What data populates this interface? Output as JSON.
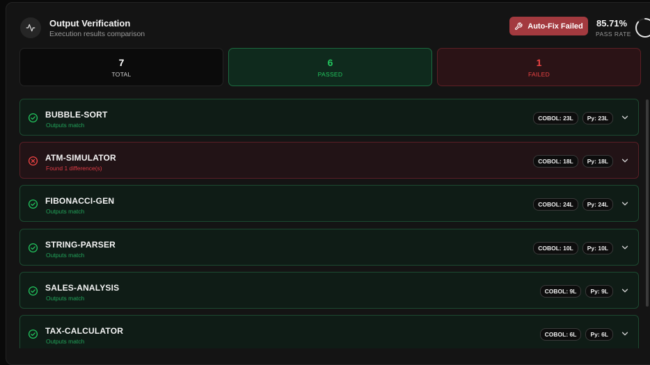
{
  "header": {
    "title": "Output Verification",
    "subtitle": "Execution results comparison",
    "autofix_label": "Auto-Fix Failed",
    "pass_rate": "85.71%",
    "pass_rate_label": "PASS RATE",
    "pass_rate_fraction": 0.8571
  },
  "stats": [
    {
      "value": "7",
      "label": "TOTAL"
    },
    {
      "value": "6",
      "label": "PASSED"
    },
    {
      "value": "1",
      "label": "FAILED"
    }
  ],
  "colors": {
    "pass": "#22c55e",
    "fail": "#ef4444",
    "autofix_bg": "#a33a3f"
  },
  "results": [
    {
      "name": "BUBBLE-SORT",
      "status": "pass",
      "message": "Outputs match",
      "cobol": "COBOL: 23L",
      "py": "Py: 23L"
    },
    {
      "name": "ATM-SIMULATOR",
      "status": "fail",
      "message": "Found 1 difference(s)",
      "cobol": "COBOL: 18L",
      "py": "Py: 18L"
    },
    {
      "name": "FIBONACCI-GEN",
      "status": "pass",
      "message": "Outputs match",
      "cobol": "COBOL: 24L",
      "py": "Py: 24L"
    },
    {
      "name": "STRING-PARSER",
      "status": "pass",
      "message": "Outputs match",
      "cobol": "COBOL: 10L",
      "py": "Py: 10L"
    },
    {
      "name": "SALES-ANALYSIS",
      "status": "pass",
      "message": "Outputs match",
      "cobol": "COBOL: 9L",
      "py": "Py: 9L"
    },
    {
      "name": "TAX-CALCULATOR",
      "status": "pass",
      "message": "Outputs match",
      "cobol": "COBOL: 6L",
      "py": "Py: 6L"
    }
  ]
}
